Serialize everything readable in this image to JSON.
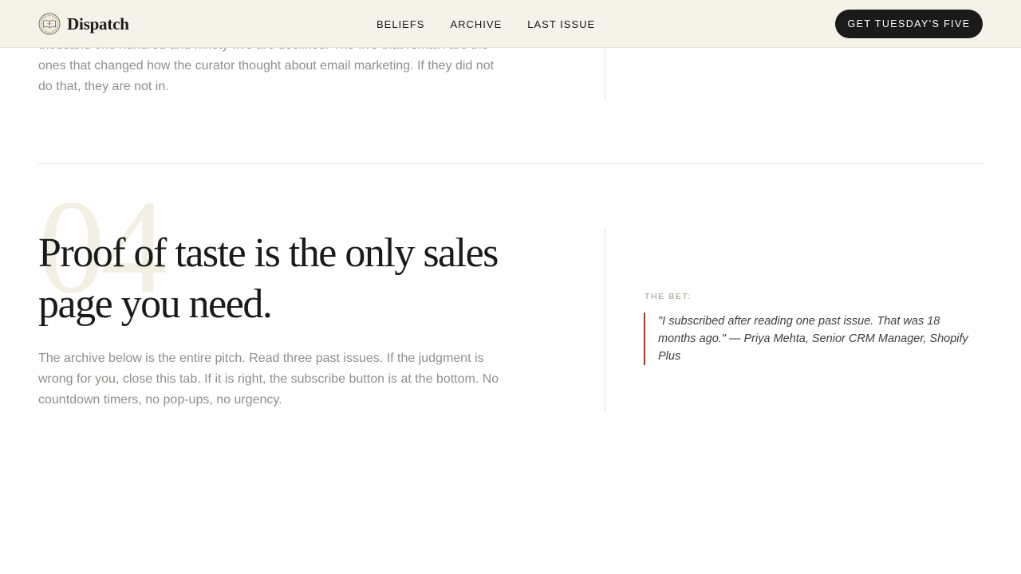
{
  "header": {
    "brand": {
      "name": "Dispatch",
      "logo_icon": "open-book-seal-icon"
    },
    "nav": [
      {
        "label": "BELIEFS"
      },
      {
        "label": "ARCHIVE"
      },
      {
        "label": "LAST ISSUE"
      }
    ],
    "cta_label": "GET TUESDAY'S FIVE"
  },
  "previous_section": {
    "body": "thousand one hundred and ninety-five are declined. The five that remain are the ones that changed how the curator thought about email marketing. If they did not do that, they are not in."
  },
  "section": {
    "number": "04",
    "headline": "Proof of taste is the only sales page you need.",
    "body": "The archive below is the entire pitch. Read three past issues. If the judgment is wrong for you, close this tab. If it is right, the subscribe button is at the bottom. No countdown timers, no pop-ups, no urgency.",
    "aside": {
      "label": "THE BET:",
      "quote": "\"I subscribed after reading one past issue. That was 18 months ago.\" — Priya Mehta, Senior CRM Manager, Shopify Plus"
    }
  },
  "colors": {
    "header_bg": "#f5f2e9",
    "cta_bg": "#1a1a1a",
    "accent_rule": "#9a3b2a",
    "muted_text": "#8f8f8a",
    "section_number": "#f2efe3"
  }
}
